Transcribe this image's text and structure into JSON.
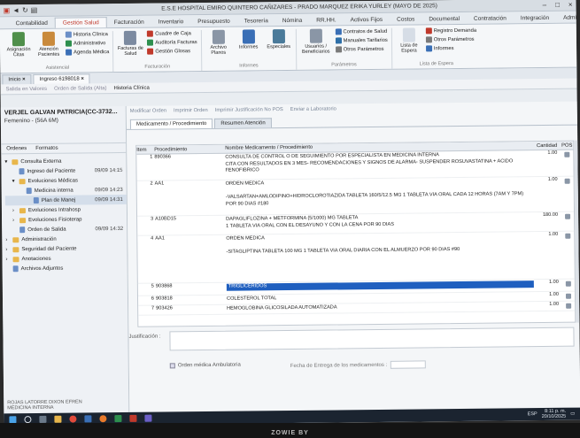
{
  "window": {
    "title": "E.S.E HOSPITAL EMIRO QUINTERO CAÑIZARES - PRADO MARQUEZ ERIKA YURLEY (MAYO DE 2025)",
    "controls": [
      "–",
      "□",
      "×"
    ]
  },
  "ribbon_tabs": [
    "Contabilidad",
    "Gestión Salud",
    "Facturación",
    "Inventario",
    "Presupuesto",
    "Tesorería",
    "Nómina",
    "RR.HH.",
    "Activos Fijos",
    "Costos",
    "Documental",
    "Contratación",
    "Integración",
    "Administración"
  ],
  "ribbon": {
    "asignacion": "Asignación Citas",
    "atencion": "Atención Pacientes",
    "historia_clinica": "Historia Clínica",
    "administrativo": "Administrativo",
    "agenda_medica": "Agenda Médica",
    "group_asistencial": "Asistencial",
    "facturas_salud": "Facturas de Salud",
    "cuadre_caja": "Cuadre de Caja",
    "auditoria_facturas": "Auditoría Facturas",
    "gestion_glosas": "Gestión Glosas",
    "group_facturacion": "Facturación",
    "archivo_planos": "Archivo Planos",
    "informes": "Informes",
    "especiales": "Especiales",
    "group_informes": "Informes",
    "usuarios_beneficiarios": "Usuarios / Beneficiarios",
    "contratos_salud": "Contratos de Salud",
    "manuales_tarifarios": "Manuales Tarifarios",
    "otros_parametros": "Otros Parámetros",
    "group_parametros": "Parámetros",
    "lista_espera": "Lista de Espera",
    "registro_demanda": "Registro Demanda",
    "otros_parametros2": "Otros Parámetros",
    "informes2": "Informes",
    "group_lista": "Lista de Espera"
  },
  "doc_tabs": [
    "Inicio",
    "Ingreso 6198018"
  ],
  "toolbar_top": {
    "salida_valores": "Salida en Valores",
    "orden_salida": "Orden de Salida (Alta)",
    "historia_clinica": "Historia Clínica"
  },
  "patient": {
    "name": "VERJEL GALVAN PATRICIA(CC-3732...",
    "sub": "Femenino - (56A 6M)"
  },
  "left_toolbar": [
    "Ordenes",
    "Formatos"
  ],
  "tree": [
    {
      "label": "Consulta Externa",
      "date": "",
      "indent": 0,
      "type": "folder"
    },
    {
      "label": "Ingreso del Paciente",
      "date": "09/09 14:15",
      "indent": 1,
      "type": "doc"
    },
    {
      "label": "Evoluciones Médicas",
      "date": "",
      "indent": 1,
      "type": "folder"
    },
    {
      "label": "Medicina interna",
      "date": "09/09 14:23",
      "indent": 2,
      "type": "doc"
    },
    {
      "label": "Plan de Manej",
      "date": "09/09 14:31",
      "indent": 3,
      "type": "doc"
    },
    {
      "label": "Evoluciones Intrahosp",
      "date": "",
      "indent": 1,
      "type": "folder"
    },
    {
      "label": "Evoluciones Fisioterap",
      "date": "",
      "indent": 1,
      "type": "folder"
    },
    {
      "label": "Orden de Salida",
      "date": "09/09 14:32",
      "indent": 1,
      "type": "doc"
    },
    {
      "label": "Administración",
      "date": "",
      "indent": 0,
      "type": "folder"
    },
    {
      "label": "Seguridad del Paciente",
      "date": "",
      "indent": 0,
      "type": "folder"
    },
    {
      "label": "Anotaciones",
      "date": "",
      "indent": 0,
      "type": "folder"
    },
    {
      "label": "Archivos Adjuntos",
      "date": "",
      "indent": 0,
      "type": "doc"
    }
  ],
  "left_footer": [
    "ROJAS LATORRE DIXON EFREN",
    "MEDICINA INTERNA"
  ],
  "right_toolbar": [
    "Modificar Orden",
    "Imprimir Orden",
    "Imprimir Justificación No POS",
    "Enviar a Laboratorio"
  ],
  "subtabs": [
    "Medicamento / Procedimiento",
    "Resumen Atención"
  ],
  "grid": {
    "headers": [
      "Item",
      "Procedimiento",
      "Nombre Medicamento / Procedimiento",
      "Cantidad",
      "POS"
    ],
    "rows": [
      {
        "item": "1",
        "code": "890366",
        "name": "CONSULTA DE CONTROL O DE SEGUIMIENTO POR ESPECIALISTA EN MEDICINA INTERNA\nCITA CON RESULTADOS EN 3 MES- RECOMENDACIONES Y SIGNOS DE ALARMA- SUSPENDER ROSUVASTATINA + ACIDO FENOFIBRICO",
        "qty": "1.00",
        "hl": false
      },
      {
        "item": "2",
        "code": "AA1",
        "name": "ORDEN MEDICA\n\n-VALSARTAN+AMLODIPINO+HIDROCLOROTIAZIDA TABLETA 160/5/12.5 MG 1 TABLETA VIA ORAL CADA 12 HORAS (7AM Y 7PM) POR 90 DIAS #180",
        "qty": "1.00",
        "hl": false
      },
      {
        "item": "3",
        "code": "A10BD15",
        "name": "DAPAGLIFLOZINA + METFORMINA (5/1000) MG TABLETA\n1 TABLETA VIA ORAL CON EL DESAYUNO Y CON LA CENA POR 90 DIAS",
        "qty": "180.00",
        "hl": false
      },
      {
        "item": "4",
        "code": "AA1",
        "name": "ORDEN MEDICA\n\n-SITAGLIPTINA TABLETA 100 MG 1 TABLETA VIA ORAL DIARIA CON EL ALMUERZO POR 90 DIAS #90",
        "qty": "1.00",
        "hl": false
      },
      {
        "item": "5",
        "code": "903868",
        "name": "TRIGLICERIDOS",
        "qty": "1.00",
        "hl": true
      },
      {
        "item": "6",
        "code": "903818",
        "name": "COLESTEROL TOTAL",
        "qty": "1.00",
        "hl": false
      },
      {
        "item": "7",
        "code": "903426",
        "name": "HEMOGLOBINA GLICOSILADA AUTOMATIZADA",
        "qty": "1.00",
        "hl": false
      }
    ]
  },
  "form": {
    "justificacion_label": "Justificación :",
    "orden_ambulatoria": "Orden médica Ambulatoria",
    "fecha_entrega": "Fecha de Entrega de los medicamentos :"
  },
  "taskbar": {
    "time": "8:11 p. m.",
    "date": "20/10/2025",
    "lang": "ESP"
  },
  "monitor_brand": "ZOWIE BY"
}
